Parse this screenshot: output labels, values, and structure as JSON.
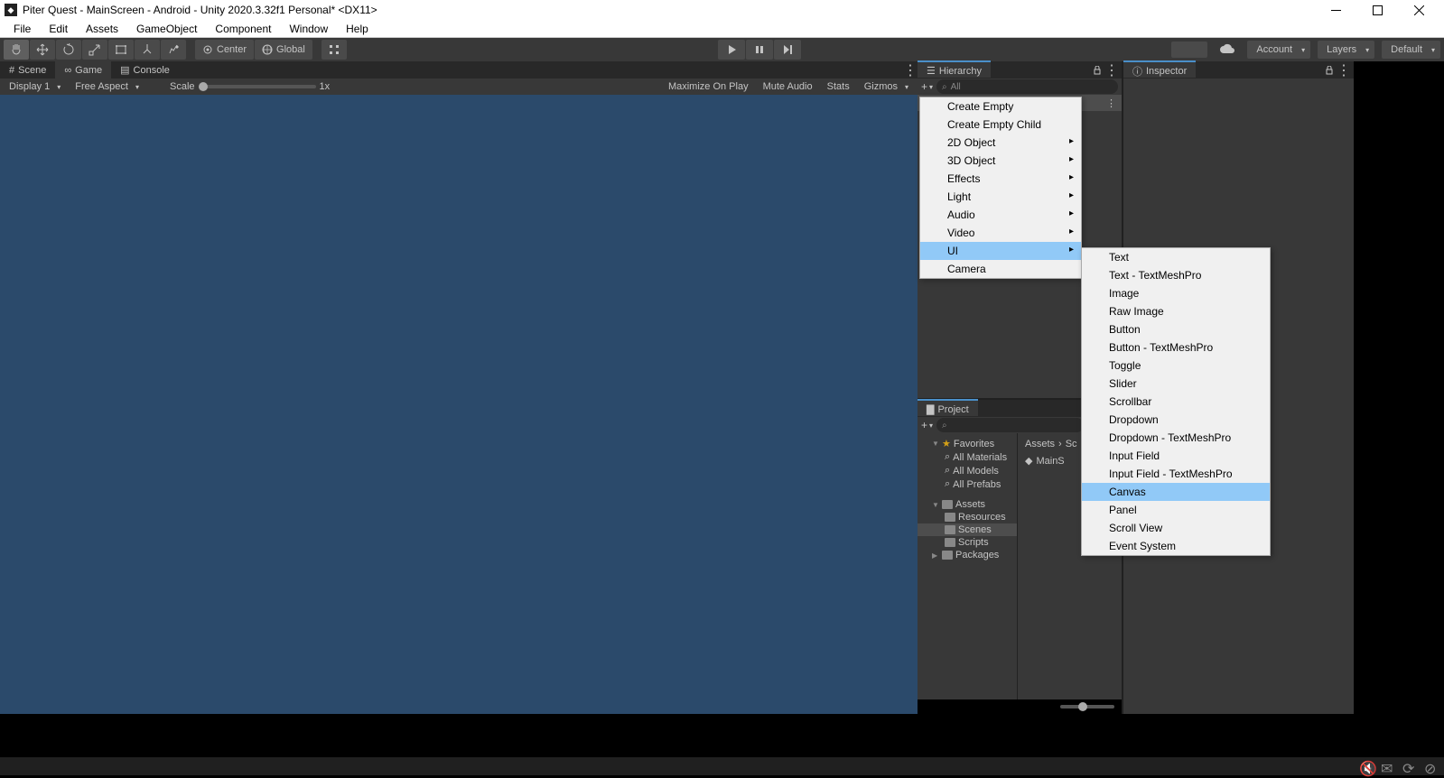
{
  "titlebar": {
    "title": "Piter Quest - MainScreen - Android - Unity 2020.3.32f1 Personal* <DX11>"
  },
  "menubar": {
    "items": [
      "File",
      "Edit",
      "Assets",
      "GameObject",
      "Component",
      "Window",
      "Help"
    ]
  },
  "toolbar": {
    "center": "Center",
    "global": "Global",
    "account": "Account",
    "layers": "Layers",
    "layout": "Default"
  },
  "tabs": {
    "scene": "Scene",
    "game": "Game",
    "console": "Console"
  },
  "gameToolbar": {
    "display": "Display 1",
    "aspect": "Free Aspect",
    "scale": "Scale",
    "scaleValue": "1x",
    "maximize": "Maximize On Play",
    "mute": "Mute Audio",
    "stats": "Stats",
    "gizmos": "Gizmos"
  },
  "hierarchy": {
    "title": "Hierarchy",
    "searchPlaceholder": "All"
  },
  "inspector": {
    "title": "Inspector"
  },
  "project": {
    "title": "Project",
    "favorites": "Favorites",
    "allMaterials": "All Materials",
    "allModels": "All Models",
    "allPrefabs": "All Prefabs",
    "assets": "Assets",
    "resources": "Resources",
    "scenes": "Scenes",
    "scripts": "Scripts",
    "packages": "Packages",
    "breadcrumbAssets": "Assets",
    "breadcrumbSc": "Sc",
    "mainS": "MainS"
  },
  "contextMenu1": {
    "items": [
      {
        "label": "Create Empty",
        "sub": false
      },
      {
        "label": "Create Empty Child",
        "sub": false
      },
      {
        "label": "2D Object",
        "sub": true
      },
      {
        "label": "3D Object",
        "sub": true
      },
      {
        "label": "Effects",
        "sub": true
      },
      {
        "label": "Light",
        "sub": true
      },
      {
        "label": "Audio",
        "sub": true
      },
      {
        "label": "Video",
        "sub": true
      },
      {
        "label": "UI",
        "sub": true,
        "highlighted": true
      },
      {
        "label": "Camera",
        "sub": false
      }
    ]
  },
  "contextMenu2": {
    "items": [
      {
        "label": "Text"
      },
      {
        "label": "Text - TextMeshPro"
      },
      {
        "label": "Image"
      },
      {
        "label": "Raw Image"
      },
      {
        "label": "Button"
      },
      {
        "label": "Button - TextMeshPro"
      },
      {
        "label": "Toggle"
      },
      {
        "label": "Slider"
      },
      {
        "label": "Scrollbar"
      },
      {
        "label": "Dropdown"
      },
      {
        "label": "Dropdown - TextMeshPro"
      },
      {
        "label": "Input Field"
      },
      {
        "label": "Input Field - TextMeshPro"
      },
      {
        "label": "Canvas",
        "highlighted": true
      },
      {
        "label": "Panel"
      },
      {
        "label": "Scroll View"
      },
      {
        "label": "Event System"
      }
    ]
  }
}
